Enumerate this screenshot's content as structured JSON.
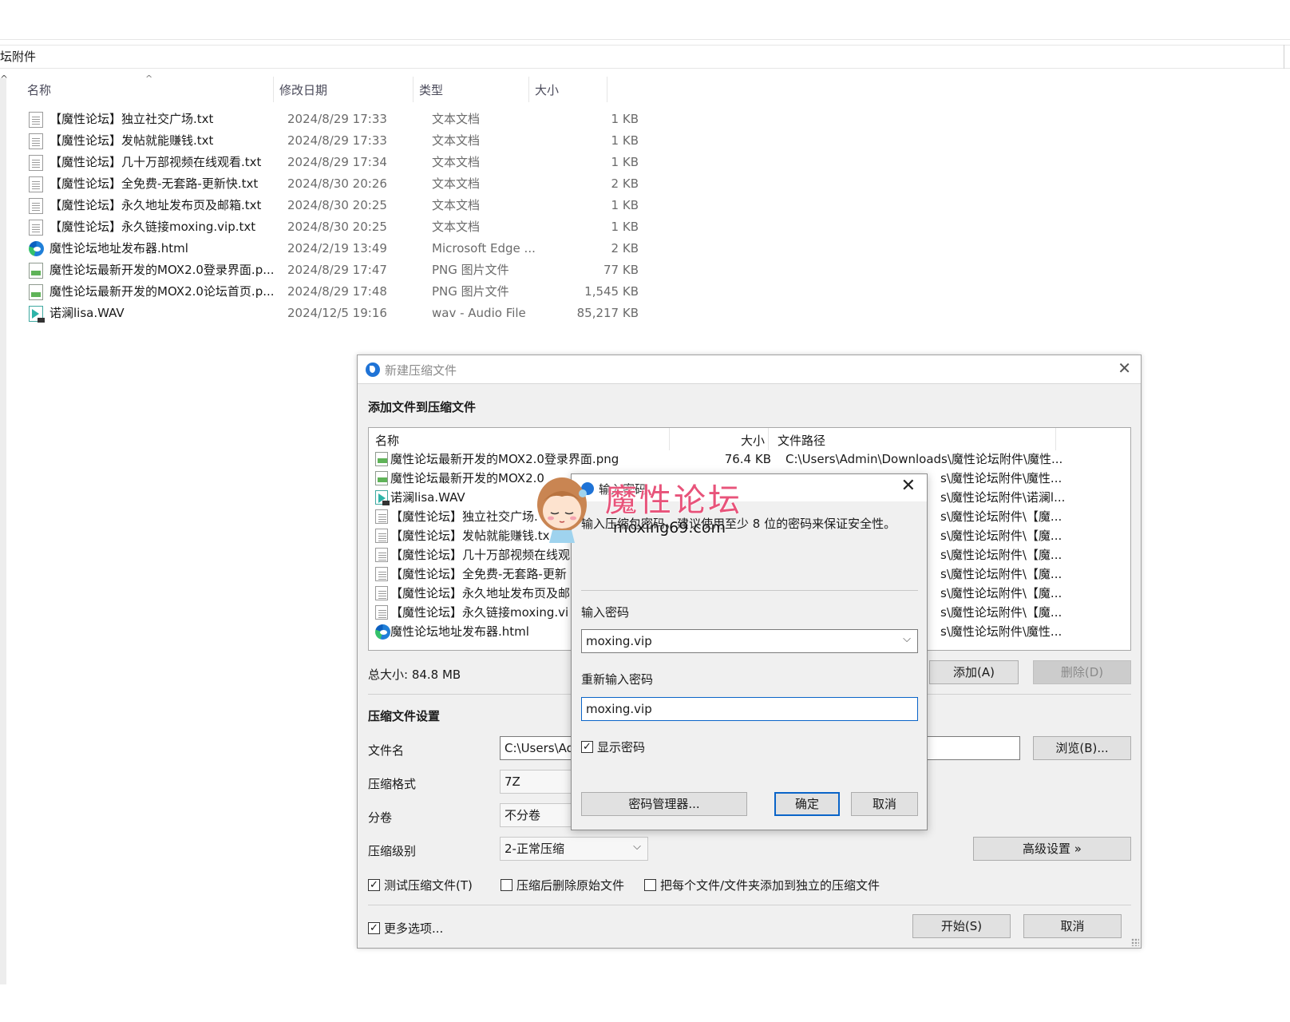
{
  "explorer": {
    "address": "坛附件",
    "columns": {
      "name": "名称",
      "modified": "修改日期",
      "type": "类型",
      "size": "大小"
    },
    "files": [
      {
        "name": "【魔性论坛】独立社交广场.txt",
        "modified": "2024/8/29 17:33",
        "type": "文本文档",
        "size": "1 KB",
        "icon": "txt"
      },
      {
        "name": "【魔性论坛】发帖就能赚钱.txt",
        "modified": "2024/8/29 17:33",
        "type": "文本文档",
        "size": "1 KB",
        "icon": "txt"
      },
      {
        "name": "【魔性论坛】几十万部视频在线观看.txt",
        "modified": "2024/8/29 17:34",
        "type": "文本文档",
        "size": "1 KB",
        "icon": "txt"
      },
      {
        "name": "【魔性论坛】全免费-无套路-更新快.txt",
        "modified": "2024/8/30 20:26",
        "type": "文本文档",
        "size": "2 KB",
        "icon": "txt"
      },
      {
        "name": "【魔性论坛】永久地址发布页及邮箱.txt",
        "modified": "2024/8/30 20:25",
        "type": "文本文档",
        "size": "1 KB",
        "icon": "txt"
      },
      {
        "name": "【魔性论坛】永久链接moxing.vip.txt",
        "modified": "2024/8/30 20:25",
        "type": "文本文档",
        "size": "1 KB",
        "icon": "txt"
      },
      {
        "name": "魔性论坛地址发布器.html",
        "modified": "2024/2/19 13:49",
        "type": "Microsoft Edge ...",
        "size": "2 KB",
        "icon": "edge"
      },
      {
        "name": "魔性论坛最新开发的MOX2.0登录界面.p...",
        "modified": "2024/8/29 17:47",
        "type": "PNG 图片文件",
        "size": "77 KB",
        "icon": "png"
      },
      {
        "name": "魔性论坛最新开发的MOX2.0论坛首页.p...",
        "modified": "2024/8/29 17:48",
        "type": "PNG 图片文件",
        "size": "1,545 KB",
        "icon": "png"
      },
      {
        "name": "诺澜lisa.WAV",
        "modified": "2024/12/5 19:16",
        "type": "wav - Audio File",
        "size": "85,217 KB",
        "icon": "wav"
      }
    ]
  },
  "archive_dialog": {
    "title": "新建压缩文件",
    "add_section": "添加文件到压缩文件",
    "list_columns": {
      "name": "名称",
      "size": "大小",
      "path": "文件路径"
    },
    "list_rows": [
      {
        "name": "魔性论坛最新开发的MOX2.0登录界面.png",
        "size": "76.4 KB",
        "path": "C:\\Users\\Admin\\Downloads\\魔性论坛附件\\魔性...",
        "icon": "png"
      },
      {
        "name": "魔性论坛最新开发的MOX2.0",
        "size": "",
        "path": "s\\魔性论坛附件\\魔性...",
        "icon": "png"
      },
      {
        "name": "诺澜lisa.WAV",
        "size": "",
        "path": "s\\魔性论坛附件\\诺澜l...",
        "icon": "wav"
      },
      {
        "name": "【魔性论坛】独立社交广场.",
        "size": "",
        "path": "s\\魔性论坛附件\\【魔...",
        "icon": "txt"
      },
      {
        "name": "【魔性论坛】发帖就能赚钱.tx",
        "size": "",
        "path": "s\\魔性论坛附件\\【魔...",
        "icon": "txt"
      },
      {
        "name": "【魔性论坛】几十万部视频在线观",
        "size": "",
        "path": "s\\魔性论坛附件\\【魔...",
        "icon": "txt"
      },
      {
        "name": "【魔性论坛】全免费-无套路-更新",
        "size": "",
        "path": "s\\魔性论坛附件\\【魔...",
        "icon": "txt"
      },
      {
        "name": "【魔性论坛】永久地址发布页及邮",
        "size": "",
        "path": "s\\魔性论坛附件\\【魔...",
        "icon": "txt"
      },
      {
        "name": "【魔性论坛】永久链接moxing.vi",
        "size": "",
        "path": "s\\魔性论坛附件\\【魔...",
        "icon": "txt"
      },
      {
        "name": "魔性论坛地址发布器.html",
        "size": "",
        "path": "s\\魔性论坛附件\\魔性...",
        "icon": "edge"
      }
    ],
    "total_size": "总大小: 84.8 MB",
    "add_button": "添加(A)",
    "delete_button": "删除(D)",
    "settings_section": "压缩文件设置",
    "filename_label": "文件名",
    "filename_value": "C:\\Users\\Ad",
    "browse_button": "浏览(B)...",
    "format_label": "压缩格式",
    "format_value": "7Z",
    "split_label": "分卷",
    "split_value": "不分卷",
    "level_label": "压缩级别",
    "level_value": "2-正常压缩",
    "advanced_button": "高级设置 »",
    "test_checkbox": "测试压缩文件(T)",
    "test_checked": true,
    "delete_after_checkbox": "压缩后删除原始文件",
    "delete_after_checked": false,
    "separate_checkbox": "把每个文件/文件夹添加到独立的压缩文件",
    "separate_checked": false,
    "more_options_checkbox": "更多选项...",
    "more_options_checked": true,
    "start_button": "开始(S)",
    "cancel_button": "取消"
  },
  "password_dialog": {
    "title": "输入密码",
    "hint": "输入压缩包密码，建议使用至少 8 位的密码来保证安全性。",
    "password_label": "输入密码",
    "password_value": "moxing.vip",
    "confirm_label": "重新输入密码",
    "confirm_value": "moxing.vip",
    "show_password": "显示密码",
    "show_password_checked": true,
    "manager_button": "密码管理器...",
    "ok_button": "确定",
    "cancel_button": "取消"
  },
  "watermark": {
    "brand": "魔性论坛",
    "url": "moxing69.com"
  },
  "colors": {
    "accent": "#0a64c8",
    "watermark_pink": "#e8537a",
    "dialog_bg": "#f0f0f0"
  }
}
